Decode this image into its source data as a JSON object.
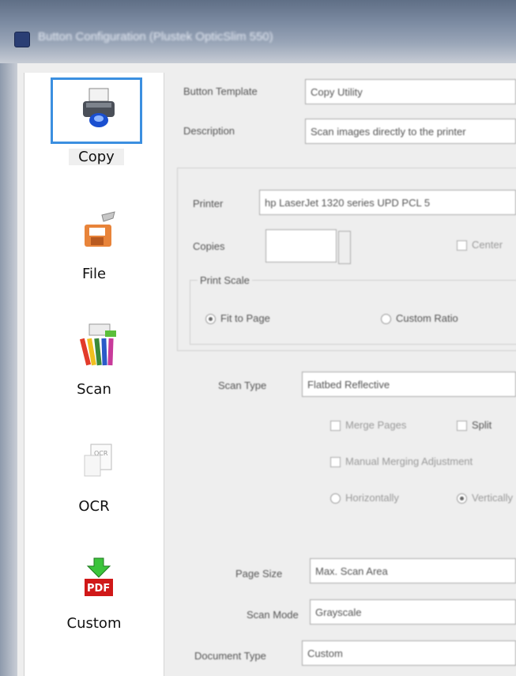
{
  "window": {
    "title": "Button Configuration (Plustek OpticSlim 550)"
  },
  "sidebar": {
    "items": [
      {
        "label": "Copy",
        "icon": "printer-icon",
        "selected": true
      },
      {
        "label": "File",
        "icon": "folder-save-icon"
      },
      {
        "label": "Scan",
        "icon": "scan-crayons-icon"
      },
      {
        "label": "OCR",
        "icon": "ocr-document-icon"
      },
      {
        "label": "Custom",
        "icon": "pdf-download-icon"
      }
    ]
  },
  "main": {
    "button_template": {
      "label": "Button Template",
      "value": "Copy Utility"
    },
    "description": {
      "label": "Description",
      "value": "Scan images directly to the printer"
    },
    "printer": {
      "label": "Printer",
      "value": "hp LaserJet 1320 series UPD PCL 5"
    },
    "copies": {
      "label": "Copies",
      "value": "",
      "checkbox_label": "Center"
    },
    "print_scale": {
      "group_label": "Print Scale",
      "fit_to_page": "Fit to Page",
      "custom_ratio": "Custom Ratio"
    },
    "scan_type": {
      "label": "Scan Type",
      "value": "Flatbed Reflective"
    },
    "options": {
      "merge_pages": "Merge Pages",
      "split": "Split",
      "manual_merging": "Manual Merging Adjustment",
      "horizontally": "Horizontally",
      "vertically": "Vertically"
    },
    "page_size": {
      "label": "Page Size",
      "value": "Max. Scan Area"
    },
    "scan_mode": {
      "label": "Scan Mode",
      "value": "Grayscale"
    },
    "document_type": {
      "label": "Document Type",
      "value": "Custom"
    }
  },
  "colors": {
    "selection_border": "#3b8fe0",
    "sidebar_bg": "#ffffff"
  }
}
